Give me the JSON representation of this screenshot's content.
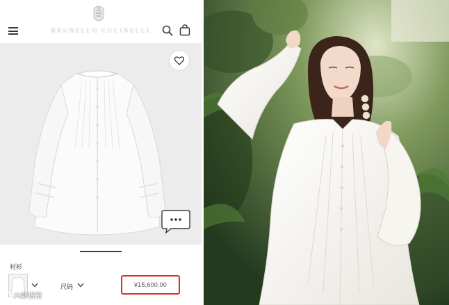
{
  "shop": {
    "header": {
      "brand_name": "BRUNELLO CUCINELLI",
      "menu_icon": "hamburger-menu-icon",
      "search_icon": "search-icon",
      "bag_icon": "shopping-bag-icon"
    },
    "product": {
      "favorite_icon": "heart-icon",
      "chat_icon": "chat-bubble-icon",
      "category": "衬衫",
      "size_label": "尺码",
      "price": "¥15,600.00"
    },
    "colors": {
      "price_highlight": "#d8311f",
      "product_background": "#ececec"
    }
  },
  "watermark": {
    "text": "八卦猎镜"
  }
}
